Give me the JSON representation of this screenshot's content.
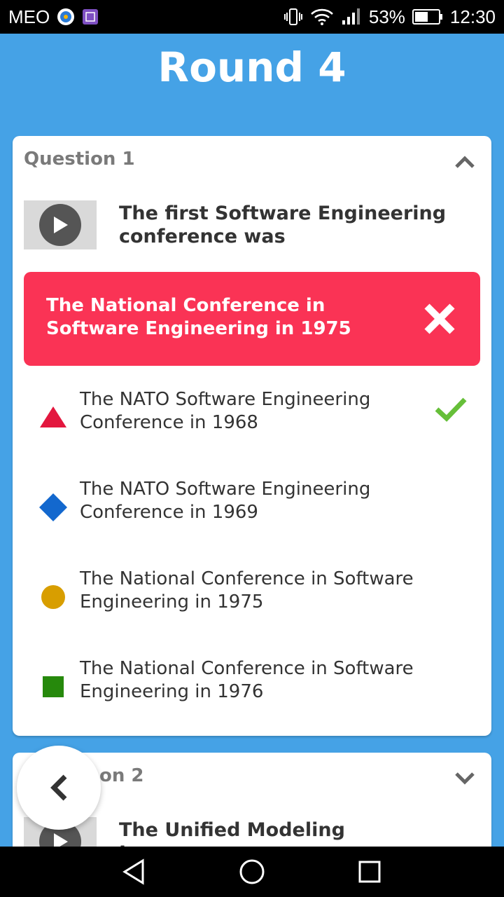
{
  "status_bar": {
    "carrier": "MEO",
    "battery": "53%",
    "time": "12:30",
    "icons": [
      "app-icon-blue",
      "app-icon-purple",
      "vibrate-icon",
      "wifi-icon",
      "signal-icon",
      "battery-icon"
    ]
  },
  "header": {
    "title": "Round 4"
  },
  "questions": [
    {
      "label": "Question 1",
      "text": "The first Software Engineering conference was",
      "chevron": "chevron-up-icon",
      "selected_wrong": {
        "text": "The National Conference in Software Engineering in 1975",
        "color": "#fa3355",
        "icon": "close-icon"
      },
      "options": [
        {
          "text": "The NATO Software Engineering Conference in 1968",
          "shape": "triangle",
          "color": "#e3173e",
          "correct": true
        },
        {
          "text": "The NATO Software Engineering Conference in 1969",
          "shape": "diamond",
          "color": "#1368ce",
          "correct": false
        },
        {
          "text": "The National Conference in Software Engineering in 1975",
          "shape": "circle",
          "color": "#d89e00",
          "correct": false
        },
        {
          "text": "The National Conference in Software Engineering in 1976",
          "shape": "square",
          "color": "#26890c",
          "correct": false
        }
      ]
    },
    {
      "label": "Question 2",
      "label_visible": "on 2",
      "text": "The Unified Modeling Language",
      "chevron": "chevron-down-icon"
    }
  ],
  "colors": {
    "background": "#45a2e6",
    "correct_check": "#66bf39"
  },
  "navigation": {
    "back_icon": "back-chevron-icon",
    "system_buttons": [
      "back-triangle-icon",
      "home-circle-icon",
      "recents-square-icon"
    ]
  }
}
